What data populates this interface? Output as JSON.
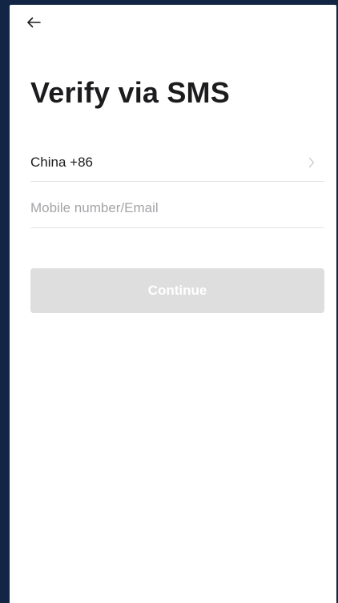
{
  "header": {
    "back_icon": "arrow-left-icon"
  },
  "page": {
    "title": "Verify via SMS"
  },
  "form": {
    "country_value": "China +86",
    "chevron_icon": "chevron-right-icon",
    "phone_placeholder": "Mobile number/Email",
    "phone_value": ""
  },
  "actions": {
    "continue_label": "Continue",
    "continue_enabled": false
  },
  "colors": {
    "frame_background": "#132544",
    "title_text": "#1c1c1e",
    "placeholder_text": "#a4a4a8",
    "divider": "#e3e3e6",
    "button_disabled_bg": "#dededf",
    "button_text": "#ffffff"
  }
}
